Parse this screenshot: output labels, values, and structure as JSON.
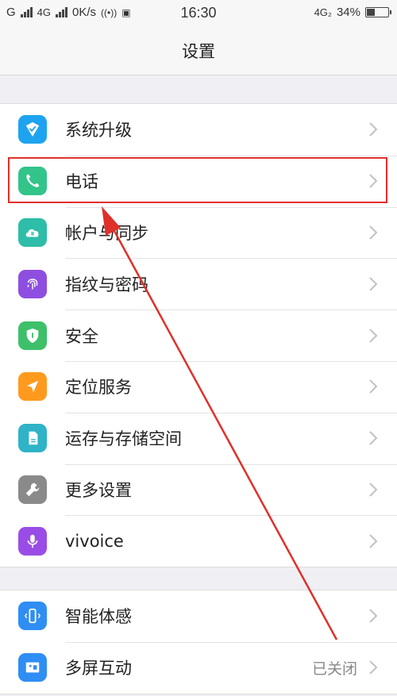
{
  "status_bar": {
    "carrier_left": "G",
    "network": "4G",
    "speed": "0K/s",
    "time": "16:30",
    "network_right": "4G₂",
    "battery_percent_text": "34%",
    "battery_level": 0.34
  },
  "nav": {
    "title": "设置"
  },
  "group1": [
    {
      "label": "系统升级",
      "icon": "system-update-icon",
      "color": "#1ea3f0"
    },
    {
      "label": "电话",
      "icon": "phone-icon",
      "color": "#33c48a"
    },
    {
      "label": "帐户与同步",
      "icon": "cloud-sync-icon",
      "color": "#2ebda8"
    },
    {
      "label": "指纹与密码",
      "icon": "fingerprint-icon",
      "color": "#8e4fe0"
    },
    {
      "label": "安全",
      "icon": "shield-icon",
      "color": "#3ec06a"
    },
    {
      "label": "定位服务",
      "icon": "location-icon",
      "color": "#ff9a1f"
    },
    {
      "label": "运存与存储空间",
      "icon": "storage-icon",
      "color": "#2eb3c7"
    },
    {
      "label": "更多设置",
      "icon": "wrench-icon",
      "color": "#8a8a8a"
    },
    {
      "label": "vivoice",
      "icon": "microphone-icon",
      "color": "#9a4de6"
    }
  ],
  "group2": [
    {
      "label": "智能体感",
      "icon": "motion-icon",
      "color": "#2f8ef3"
    },
    {
      "label": "多屏互动",
      "icon": "multiscreen-icon",
      "color": "#2f8ef3",
      "value": "已关闭"
    }
  ],
  "annotation": {
    "highlight_color": "#e0302a"
  }
}
